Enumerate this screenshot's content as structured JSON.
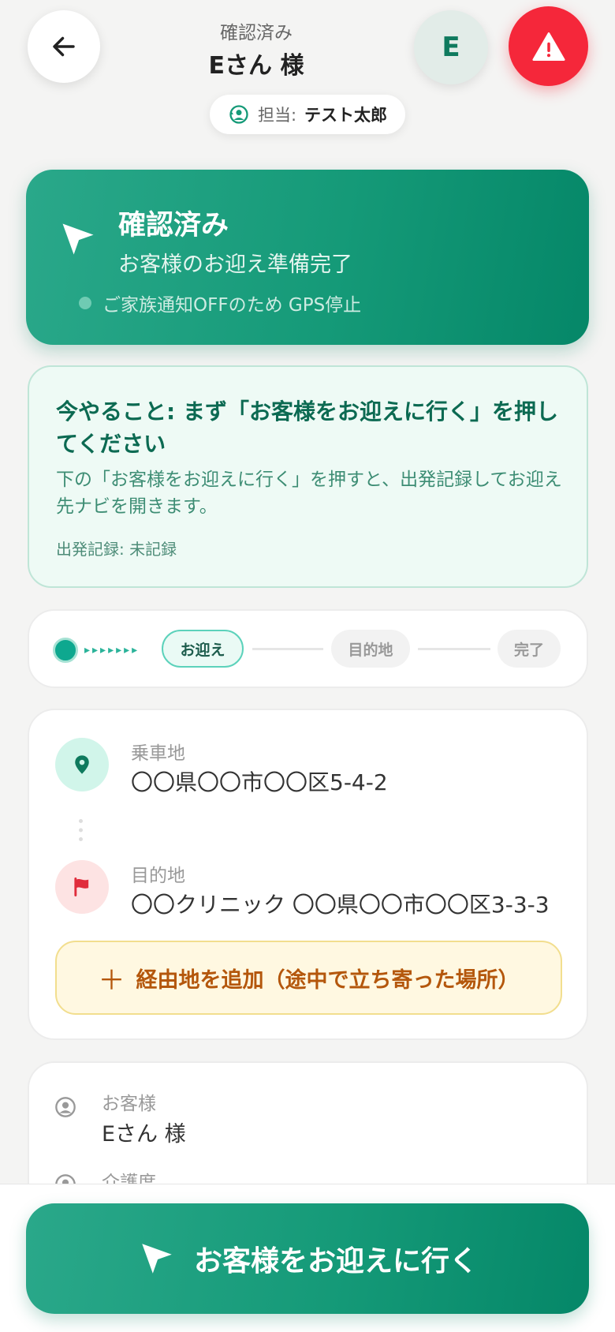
{
  "header": {
    "back_icon": "arrow-left-icon",
    "subtitle": "確認済み",
    "title": "Eさん 様",
    "avatar_initial": "E",
    "alert_icon": "warning-icon",
    "assignee_label": "担当:",
    "assignee_name": "テスト太郎"
  },
  "status": {
    "title": "確認済み",
    "description": "お客様のお迎え準備完了",
    "note": "ご家族通知OFFのため GPS停止"
  },
  "guide": {
    "title": "今やること: まず「お客様をお迎えに行く」を押してください",
    "body": "下の「お客様をお迎えに行く」を押すと、出発記録してお迎え先ナビを開きます。",
    "record": "出発記録: 未記録"
  },
  "progress": {
    "steps": [
      "お迎え",
      "目的地",
      "完了"
    ],
    "current_step": 0
  },
  "route": {
    "pickup_label": "乗車地",
    "pickup_value": "〇〇県〇〇市〇〇区5-4-2",
    "destination_label": "目的地",
    "destination_value": "〇〇クリニック 〇〇県〇〇市〇〇区3-3-3",
    "add_stop_label": "経由地を追加（途中で立ち寄った場所）"
  },
  "customer": {
    "label": "お客様",
    "value": "Eさん 様",
    "care_label": "介護度"
  },
  "bottom": {
    "primary_label": "お客様をお迎えに行く"
  },
  "colors": {
    "brand": "#159a78",
    "alert": "#f5273a",
    "accent_text": "#0c6a52"
  }
}
